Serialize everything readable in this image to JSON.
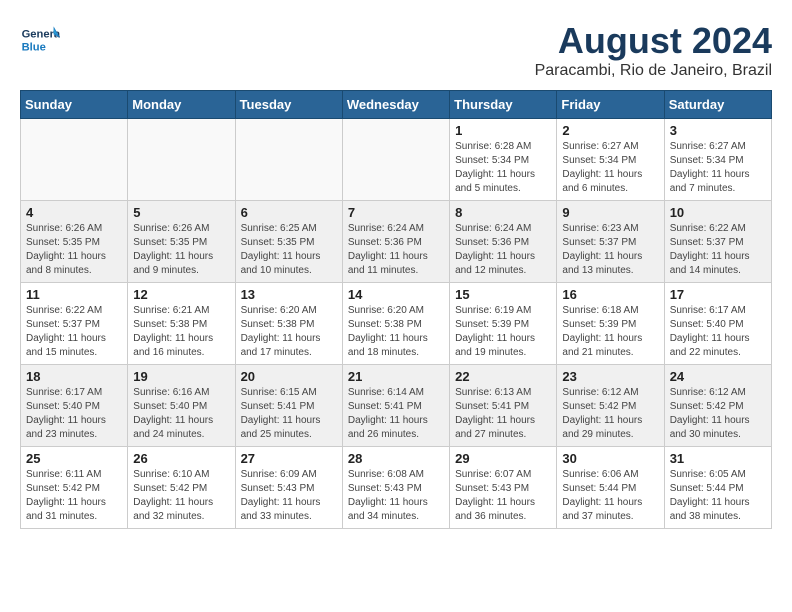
{
  "header": {
    "logo_line1": "General",
    "logo_line2": "Blue",
    "month": "August 2024",
    "location": "Paracambi, Rio de Janeiro, Brazil"
  },
  "days_of_week": [
    "Sunday",
    "Monday",
    "Tuesday",
    "Wednesday",
    "Thursday",
    "Friday",
    "Saturday"
  ],
  "weeks": [
    [
      {
        "day": "",
        "info": ""
      },
      {
        "day": "",
        "info": ""
      },
      {
        "day": "",
        "info": ""
      },
      {
        "day": "",
        "info": ""
      },
      {
        "day": "1",
        "info": "Sunrise: 6:28 AM\nSunset: 5:34 PM\nDaylight: 11 hours\nand 5 minutes."
      },
      {
        "day": "2",
        "info": "Sunrise: 6:27 AM\nSunset: 5:34 PM\nDaylight: 11 hours\nand 6 minutes."
      },
      {
        "day": "3",
        "info": "Sunrise: 6:27 AM\nSunset: 5:34 PM\nDaylight: 11 hours\nand 7 minutes."
      }
    ],
    [
      {
        "day": "4",
        "info": "Sunrise: 6:26 AM\nSunset: 5:35 PM\nDaylight: 11 hours\nand 8 minutes."
      },
      {
        "day": "5",
        "info": "Sunrise: 6:26 AM\nSunset: 5:35 PM\nDaylight: 11 hours\nand 9 minutes."
      },
      {
        "day": "6",
        "info": "Sunrise: 6:25 AM\nSunset: 5:35 PM\nDaylight: 11 hours\nand 10 minutes."
      },
      {
        "day": "7",
        "info": "Sunrise: 6:24 AM\nSunset: 5:36 PM\nDaylight: 11 hours\nand 11 minutes."
      },
      {
        "day": "8",
        "info": "Sunrise: 6:24 AM\nSunset: 5:36 PM\nDaylight: 11 hours\nand 12 minutes."
      },
      {
        "day": "9",
        "info": "Sunrise: 6:23 AM\nSunset: 5:37 PM\nDaylight: 11 hours\nand 13 minutes."
      },
      {
        "day": "10",
        "info": "Sunrise: 6:22 AM\nSunset: 5:37 PM\nDaylight: 11 hours\nand 14 minutes."
      }
    ],
    [
      {
        "day": "11",
        "info": "Sunrise: 6:22 AM\nSunset: 5:37 PM\nDaylight: 11 hours\nand 15 minutes."
      },
      {
        "day": "12",
        "info": "Sunrise: 6:21 AM\nSunset: 5:38 PM\nDaylight: 11 hours\nand 16 minutes."
      },
      {
        "day": "13",
        "info": "Sunrise: 6:20 AM\nSunset: 5:38 PM\nDaylight: 11 hours\nand 17 minutes."
      },
      {
        "day": "14",
        "info": "Sunrise: 6:20 AM\nSunset: 5:38 PM\nDaylight: 11 hours\nand 18 minutes."
      },
      {
        "day": "15",
        "info": "Sunrise: 6:19 AM\nSunset: 5:39 PM\nDaylight: 11 hours\nand 19 minutes."
      },
      {
        "day": "16",
        "info": "Sunrise: 6:18 AM\nSunset: 5:39 PM\nDaylight: 11 hours\nand 21 minutes."
      },
      {
        "day": "17",
        "info": "Sunrise: 6:17 AM\nSunset: 5:40 PM\nDaylight: 11 hours\nand 22 minutes."
      }
    ],
    [
      {
        "day": "18",
        "info": "Sunrise: 6:17 AM\nSunset: 5:40 PM\nDaylight: 11 hours\nand 23 minutes."
      },
      {
        "day": "19",
        "info": "Sunrise: 6:16 AM\nSunset: 5:40 PM\nDaylight: 11 hours\nand 24 minutes."
      },
      {
        "day": "20",
        "info": "Sunrise: 6:15 AM\nSunset: 5:41 PM\nDaylight: 11 hours\nand 25 minutes."
      },
      {
        "day": "21",
        "info": "Sunrise: 6:14 AM\nSunset: 5:41 PM\nDaylight: 11 hours\nand 26 minutes."
      },
      {
        "day": "22",
        "info": "Sunrise: 6:13 AM\nSunset: 5:41 PM\nDaylight: 11 hours\nand 27 minutes."
      },
      {
        "day": "23",
        "info": "Sunrise: 6:12 AM\nSunset: 5:42 PM\nDaylight: 11 hours\nand 29 minutes."
      },
      {
        "day": "24",
        "info": "Sunrise: 6:12 AM\nSunset: 5:42 PM\nDaylight: 11 hours\nand 30 minutes."
      }
    ],
    [
      {
        "day": "25",
        "info": "Sunrise: 6:11 AM\nSunset: 5:42 PM\nDaylight: 11 hours\nand 31 minutes."
      },
      {
        "day": "26",
        "info": "Sunrise: 6:10 AM\nSunset: 5:42 PM\nDaylight: 11 hours\nand 32 minutes."
      },
      {
        "day": "27",
        "info": "Sunrise: 6:09 AM\nSunset: 5:43 PM\nDaylight: 11 hours\nand 33 minutes."
      },
      {
        "day": "28",
        "info": "Sunrise: 6:08 AM\nSunset: 5:43 PM\nDaylight: 11 hours\nand 34 minutes."
      },
      {
        "day": "29",
        "info": "Sunrise: 6:07 AM\nSunset: 5:43 PM\nDaylight: 11 hours\nand 36 minutes."
      },
      {
        "day": "30",
        "info": "Sunrise: 6:06 AM\nSunset: 5:44 PM\nDaylight: 11 hours\nand 37 minutes."
      },
      {
        "day": "31",
        "info": "Sunrise: 6:05 AM\nSunset: 5:44 PM\nDaylight: 11 hours\nand 38 minutes."
      }
    ]
  ]
}
